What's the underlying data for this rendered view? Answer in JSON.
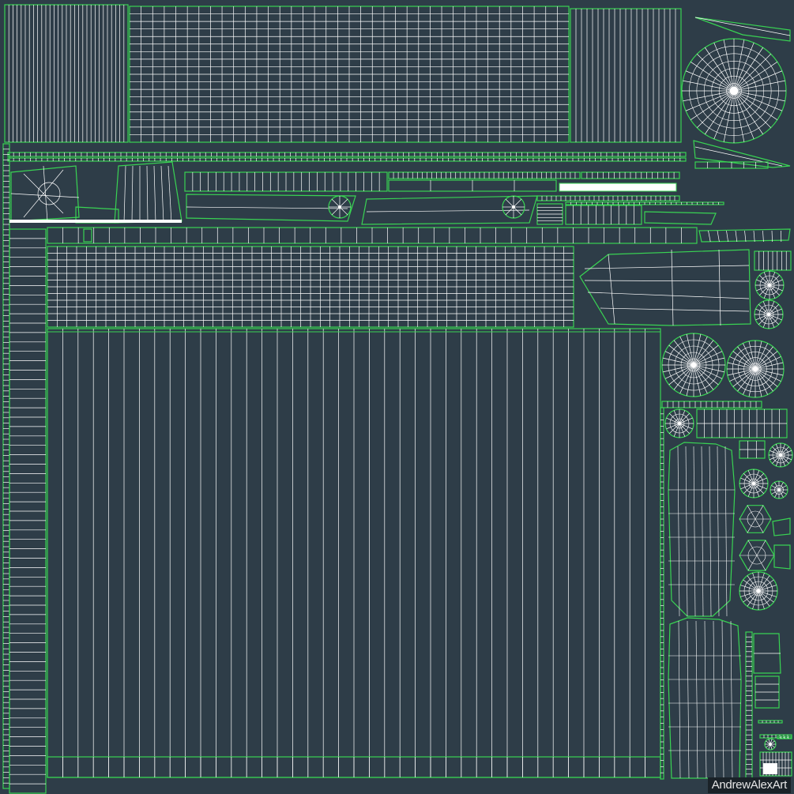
{
  "texture": {
    "background_color": "#2e3d48",
    "edge_color": "#ffffff",
    "border_color": "#39d353",
    "fill_highlight_color": "#ffffff"
  },
  "watermark": {
    "text": "AndrewAlexArt"
  }
}
